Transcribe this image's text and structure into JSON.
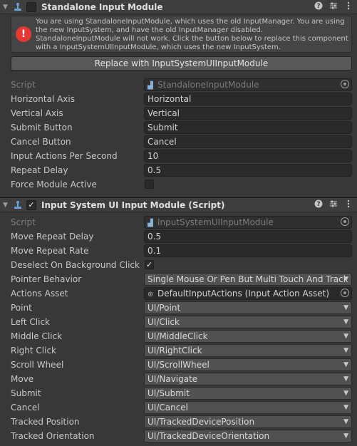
{
  "standalone": {
    "title": "Standalone Input Module",
    "warning": "You are using StandaloneInputModule, which uses the old InputManager. You are using the new InputSystem, and have the old InputManager disabled. StandaloneInputModule will not work. Click the button below to replace this component with a InputSystemUIInputModule, which uses the new InputSystem.",
    "replace_button": "Replace with InputSystemUIInputModule",
    "script_label": "Script",
    "script_value": "StandaloneInputModule",
    "fields": [
      {
        "label": "Horizontal Axis",
        "value": "Horizontal"
      },
      {
        "label": "Vertical Axis",
        "value": "Vertical"
      },
      {
        "label": "Submit Button",
        "value": "Submit"
      },
      {
        "label": "Cancel Button",
        "value": "Cancel"
      },
      {
        "label": "Input Actions Per Second",
        "value": "10"
      },
      {
        "label": "Repeat Delay",
        "value": "0.5"
      }
    ],
    "force_label": "Force Module Active",
    "force_checked": false
  },
  "uimodule": {
    "title": "Input System UI Input Module (Script)",
    "enabled": true,
    "script_label": "Script",
    "script_value": "InputSystemUIInputModule",
    "move_repeat_delay_label": "Move Repeat Delay",
    "move_repeat_delay": "0.5",
    "move_repeat_rate_label": "Move Repeat Rate",
    "move_repeat_rate": "0.1",
    "deselect_label": "Deselect On Background Click",
    "deselect_checked": "✓",
    "pointer_behavior_label": "Pointer Behavior",
    "pointer_behavior": "Single Mouse Or Pen But Multi Touch And Track",
    "actions_asset_label": "Actions Asset",
    "actions_asset": "DefaultInputActions (Input Action Asset)",
    "actions": [
      {
        "label": "Point",
        "value": "UI/Point"
      },
      {
        "label": "Left Click",
        "value": "UI/Click"
      },
      {
        "label": "Middle Click",
        "value": "UI/MiddleClick"
      },
      {
        "label": "Right Click",
        "value": "UI/RightClick"
      },
      {
        "label": "Scroll Wheel",
        "value": "UI/ScrollWheel"
      },
      {
        "label": "Move",
        "value": "UI/Navigate"
      },
      {
        "label": "Submit",
        "value": "UI/Submit"
      },
      {
        "label": "Cancel",
        "value": "UI/Cancel"
      },
      {
        "label": "Tracked Position",
        "value": "UI/TrackedDevicePosition"
      },
      {
        "label": "Tracked Orientation",
        "value": "UI/TrackedDeviceOrientation"
      }
    ]
  },
  "icons": {
    "fold": "foldout-arrow-icon",
    "help": "help-icon",
    "presets": "presets-icon",
    "menu": "kebab-menu-icon",
    "error": "error-icon",
    "script": "script-file-icon",
    "target": "object-picker-icon",
    "dropdown": "dropdown-arrow-icon"
  }
}
